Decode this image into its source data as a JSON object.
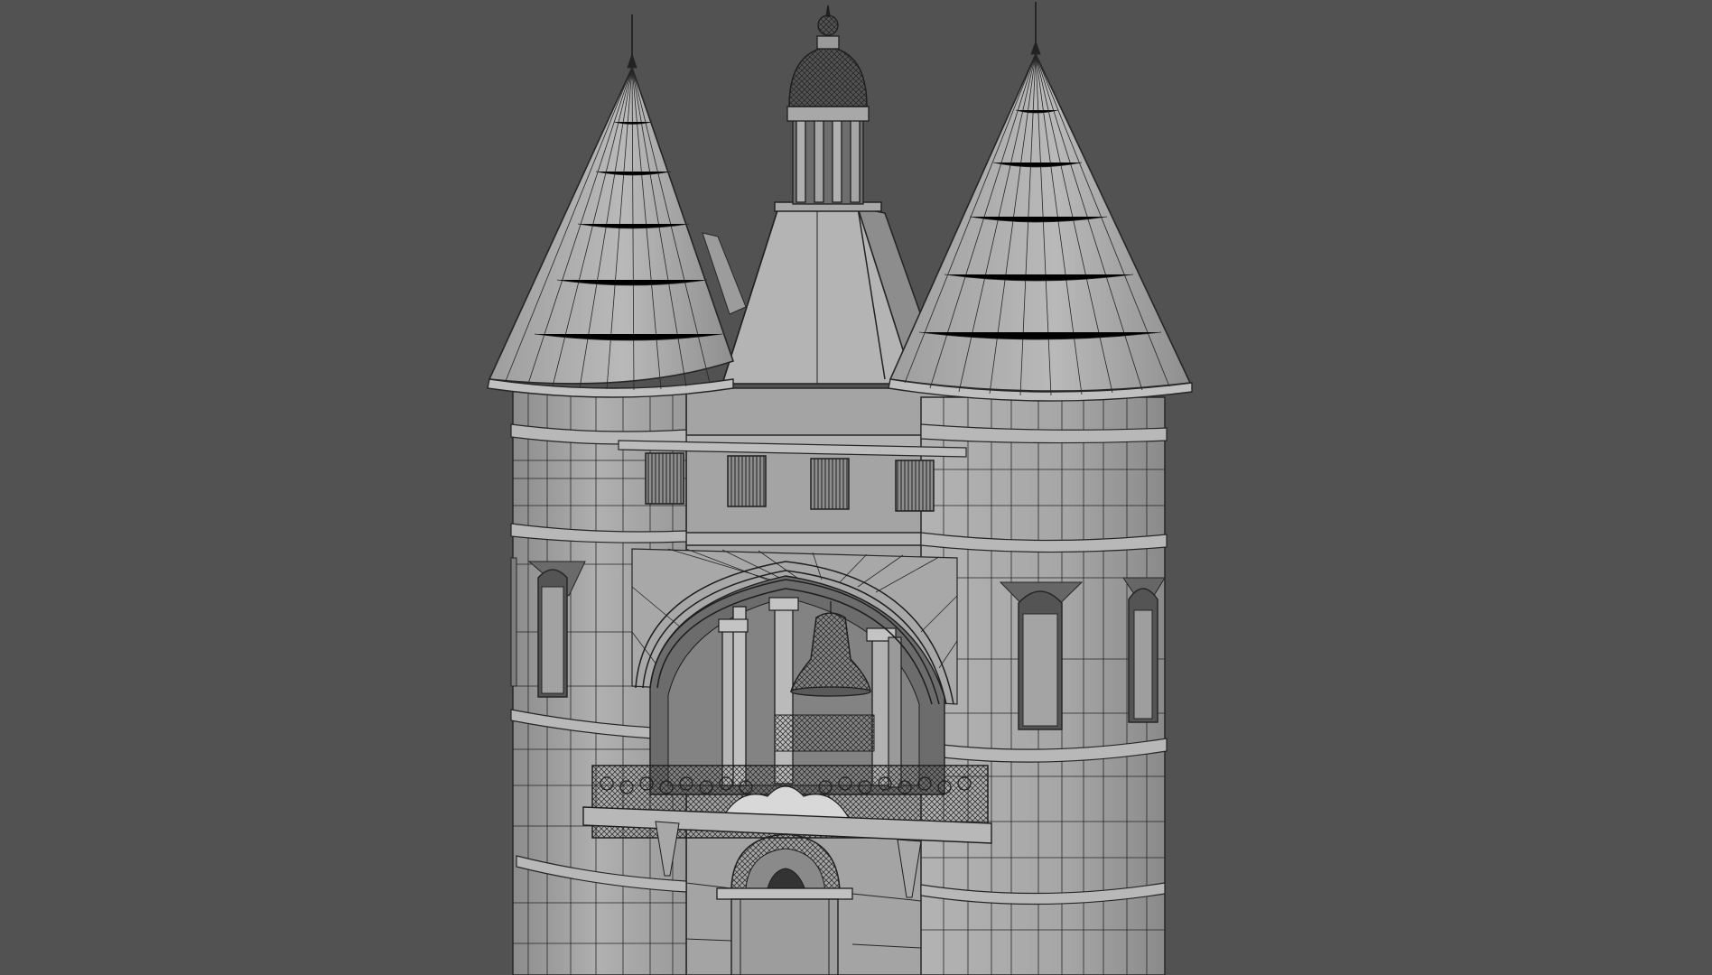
{
  "scene": {
    "subject": "belfry-gate-wireframe-render",
    "background_color": "#525252",
    "surface_color": "#a9a9a9",
    "wire_color": "#262626"
  }
}
